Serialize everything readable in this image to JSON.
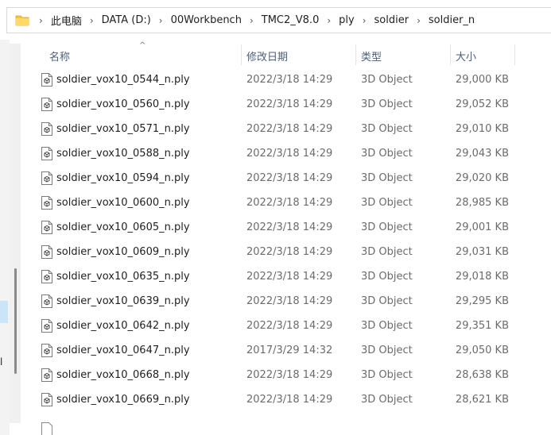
{
  "breadcrumb": [
    "此电脑",
    "DATA (D:)",
    "00Workbench",
    "TMC2_V8.0",
    "ply",
    "soldier",
    "soldier_n"
  ],
  "columns": {
    "name": "名称",
    "date": "修改日期",
    "type": "类型",
    "size": "大小"
  },
  "nav_fragment": "l",
  "files": [
    {
      "name": "soldier_vox10_0544_n.ply",
      "date": "2022/3/18 14:29",
      "type": "3D Object",
      "size": "29,000 KB"
    },
    {
      "name": "soldier_vox10_0560_n.ply",
      "date": "2022/3/18 14:29",
      "type": "3D Object",
      "size": "29,052 KB"
    },
    {
      "name": "soldier_vox10_0571_n.ply",
      "date": "2022/3/18 14:29",
      "type": "3D Object",
      "size": "29,010 KB"
    },
    {
      "name": "soldier_vox10_0588_n.ply",
      "date": "2022/3/18 14:29",
      "type": "3D Object",
      "size": "29,043 KB"
    },
    {
      "name": "soldier_vox10_0594_n.ply",
      "date": "2022/3/18 14:29",
      "type": "3D Object",
      "size": "29,020 KB"
    },
    {
      "name": "soldier_vox10_0600_n.ply",
      "date": "2022/3/18 14:29",
      "type": "3D Object",
      "size": "28,985 KB"
    },
    {
      "name": "soldier_vox10_0605_n.ply",
      "date": "2022/3/18 14:29",
      "type": "3D Object",
      "size": "29,001 KB"
    },
    {
      "name": "soldier_vox10_0609_n.ply",
      "date": "2022/3/18 14:29",
      "type": "3D Object",
      "size": "29,031 KB"
    },
    {
      "name": "soldier_vox10_0635_n.ply",
      "date": "2022/3/18 14:29",
      "type": "3D Object",
      "size": "29,018 KB"
    },
    {
      "name": "soldier_vox10_0639_n.ply",
      "date": "2022/3/18 14:29",
      "type": "3D Object",
      "size": "29,295 KB"
    },
    {
      "name": "soldier_vox10_0642_n.ply",
      "date": "2022/3/18 14:29",
      "type": "3D Object",
      "size": "29,351 KB"
    },
    {
      "name": "soldier_vox10_0647_n.ply",
      "date": "2017/3/29 14:32",
      "type": "3D Object",
      "size": "29,050 KB"
    },
    {
      "name": "soldier_vox10_0668_n.ply",
      "date": "2022/3/18 14:29",
      "type": "3D Object",
      "size": "28,638 KB"
    },
    {
      "name": "soldier_vox10_0669_n.ply",
      "date": "2022/3/18 14:29",
      "type": "3D Object",
      "size": "28,621 KB"
    }
  ],
  "icons": {
    "folder": "folder-icon",
    "file": "3d-file-icon",
    "separator": "chevron-right-icon",
    "sort": "sort-up-icon"
  },
  "colors": {
    "folder": "#f5c447",
    "header_text": "#4c607a"
  }
}
